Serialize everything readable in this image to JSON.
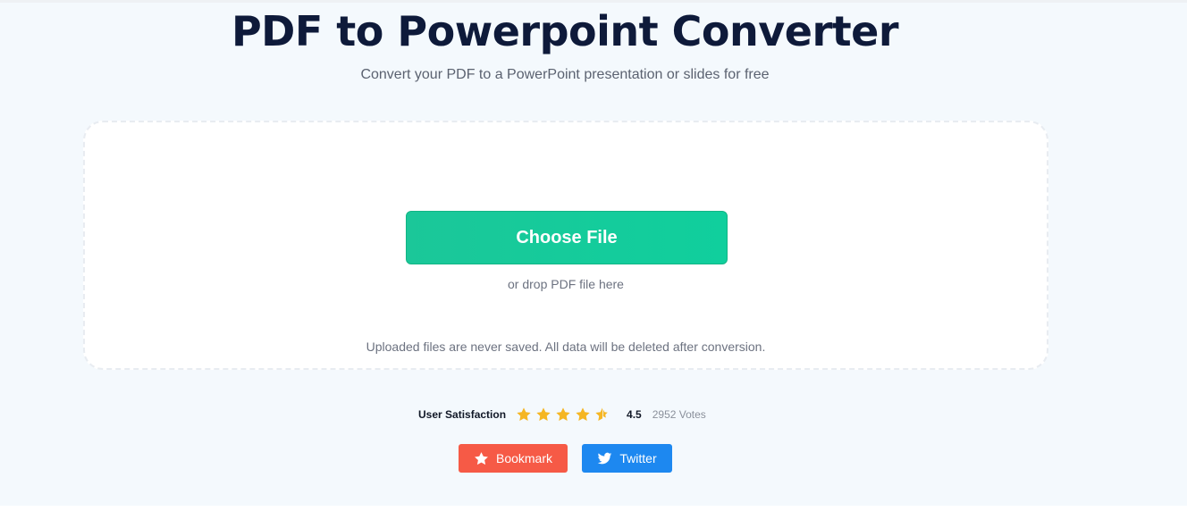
{
  "header": {
    "title": "PDF to Powerpoint Converter",
    "subtitle": "Convert your PDF to a PowerPoint presentation or slides for free"
  },
  "upload": {
    "choose_file_label": "Choose File",
    "drop_hint": "or drop PDF file here",
    "privacy_note": "Uploaded files are never saved. All data will be deleted after conversion."
  },
  "rating": {
    "label": "User Satisfaction",
    "score": "4.5",
    "score_value": 4.5,
    "max_stars": 5,
    "votes": "2952 Votes",
    "star_color": "#f5b623"
  },
  "share": {
    "bookmark_label": "Bookmark",
    "bookmark_icon": "star-icon",
    "bookmark_color": "#f65a46",
    "twitter_label": "Twitter",
    "twitter_icon": "twitter-bird-icon",
    "twitter_color": "#1d88f0"
  },
  "colors": {
    "accent_green": "#14c997",
    "title": "#0e1a3a",
    "hero_background": "#f4f9fd"
  }
}
